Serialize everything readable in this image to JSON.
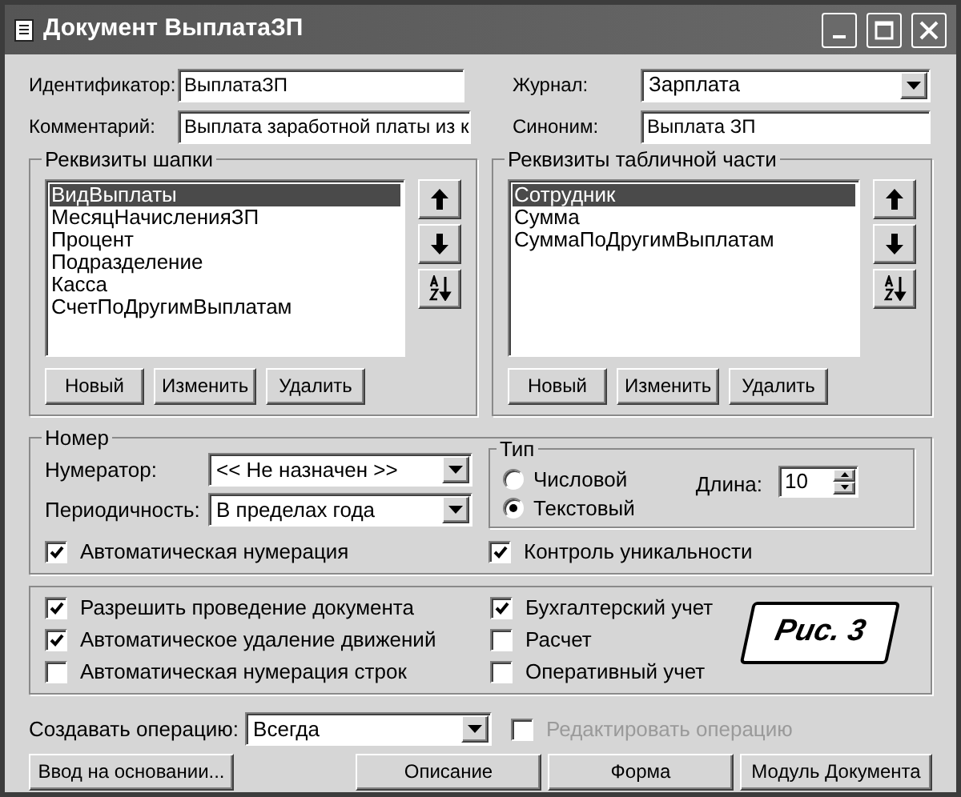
{
  "window": {
    "title": "Документ ВыплатаЗП"
  },
  "top_fields": [
    {
      "label": "Идентификатор:",
      "value": "ВыплатаЗП",
      "kind": "input"
    },
    {
      "label": "Журнал:",
      "value": "Зарплата",
      "kind": "combo"
    },
    {
      "label": "Комментарий:",
      "value": "Выплата заработной платы из к",
      "kind": "input"
    },
    {
      "label": "Синоним:",
      "value": "Выплата ЗП",
      "kind": "input"
    }
  ],
  "lists": [
    {
      "title": "Реквизиты шапки",
      "items": [
        {
          "text": "ВидВыплаты",
          "selected": true
        },
        {
          "text": "МесяцНачисленияЗП",
          "selected": false
        },
        {
          "text": "Процент",
          "selected": false
        },
        {
          "text": "Подразделение",
          "selected": false
        },
        {
          "text": "Касса",
          "selected": false
        },
        {
          "text": "СчетПоДругимВыплатам",
          "selected": false
        }
      ],
      "buttons": [
        "Новый",
        "Изменить",
        "Удалить"
      ]
    },
    {
      "title": "Реквизиты табличной части",
      "items": [
        {
          "text": "Сотрудник",
          "selected": true
        },
        {
          "text": "Сумма",
          "selected": false
        },
        {
          "text": "СуммаПоДругимВыплатам",
          "selected": false
        }
      ],
      "buttons": [
        "Новый",
        "Изменить",
        "Удалить"
      ]
    }
  ],
  "number": {
    "title": "Номер",
    "combos": [
      {
        "label": "Нумератор:",
        "value": "<< Не назначен >>"
      },
      {
        "label": "Периодичность:",
        "value": "В пределах года"
      }
    ],
    "type": {
      "title": "Тип",
      "options": [
        {
          "label": "Числовой",
          "selected": false
        },
        {
          "label": "Текстовый",
          "selected": true
        }
      ],
      "length_label": "Длина:",
      "length_value": "10"
    },
    "checks": [
      {
        "label": "Автоматическая нумерация",
        "checked": true
      },
      {
        "label": "Контроль уникальности",
        "checked": true
      }
    ]
  },
  "options": {
    "left": [
      {
        "label": "Разрешить проведение документа",
        "checked": true
      },
      {
        "label": "Автоматическое удаление движений",
        "checked": true
      },
      {
        "label": "Автоматическая нумерация строк",
        "checked": false
      }
    ],
    "right": [
      {
        "label": "Бухгалтерский учет",
        "checked": true
      },
      {
        "label": "Расчет",
        "checked": false
      },
      {
        "label": "Оперативный учет",
        "checked": false
      }
    ],
    "badge": "Рис. 3"
  },
  "operation": {
    "label": "Создавать операцию:",
    "value": "Всегда",
    "edit": {
      "label": "Редактировать операцию",
      "checked": false,
      "disabled": true
    }
  },
  "buttons": [
    "Ввод на основании...",
    "Описание",
    "Форма",
    "Модуль Документа"
  ]
}
